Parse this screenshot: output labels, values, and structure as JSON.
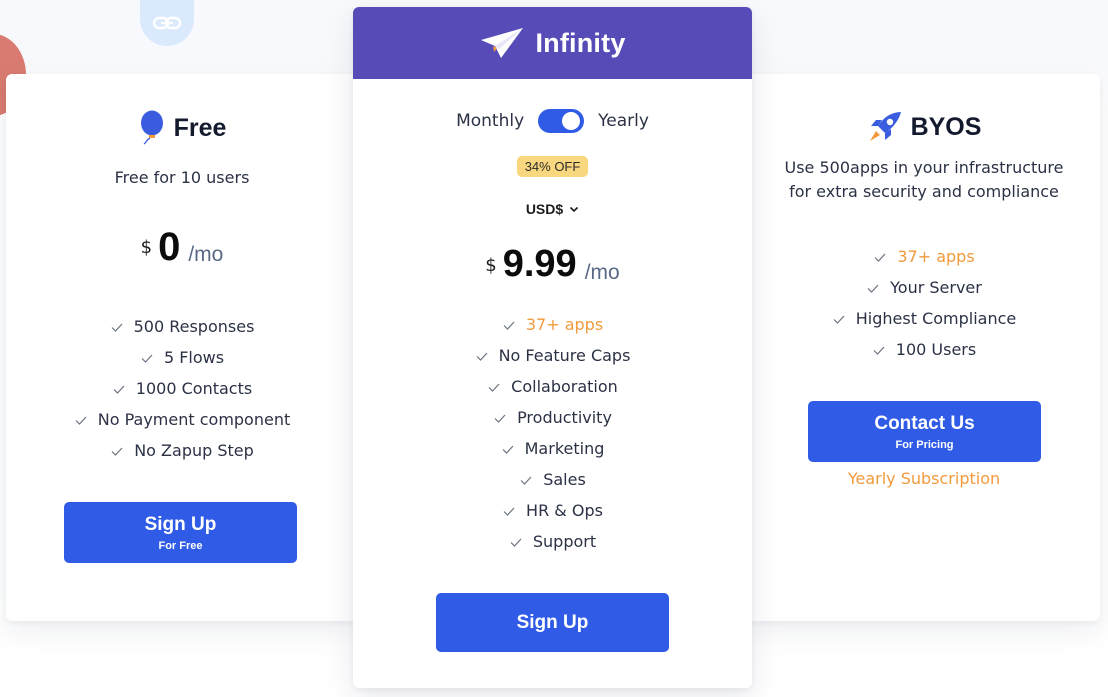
{
  "colors": {
    "primary": "#2f5be6",
    "infinity_header": "#574bb8",
    "highlight": "#f39a3d",
    "badge": "#f9d77e"
  },
  "plans": {
    "free": {
      "icon": "balloon-icon",
      "name": "Free",
      "subtitle": "Free for 10 users",
      "currency_symbol": "$",
      "amount": "0",
      "period": "/mo",
      "features": [
        {
          "text": "500 Responses",
          "highlight": false
        },
        {
          "text": "5 Flows",
          "highlight": false
        },
        {
          "text": "1000 Contacts",
          "highlight": false
        },
        {
          "text": "No Payment component",
          "highlight": false
        },
        {
          "text": "No Zapup Step",
          "highlight": false
        }
      ],
      "button": {
        "label": "Sign Up",
        "sublabel": "For Free"
      }
    },
    "infinity": {
      "icon": "paper-plane-icon",
      "name": "Infinity",
      "billing_toggle": {
        "left_label": "Monthly",
        "right_label": "Yearly",
        "selected": "Yearly"
      },
      "discount_badge": "34% OFF",
      "currency_select": "USD$",
      "currency_symbol": "$",
      "amount": "9.99",
      "period": "/mo",
      "features": [
        {
          "text": "37+ apps",
          "highlight": true
        },
        {
          "text": "No Feature Caps",
          "highlight": false
        },
        {
          "text": "Collaboration",
          "highlight": false
        },
        {
          "text": "Productivity",
          "highlight": false
        },
        {
          "text": "Marketing",
          "highlight": false
        },
        {
          "text": "Sales",
          "highlight": false
        },
        {
          "text": "HR & Ops",
          "highlight": false
        },
        {
          "text": "Support",
          "highlight": false
        }
      ],
      "button": {
        "label": "Sign Up"
      }
    },
    "byos": {
      "icon": "rocket-icon",
      "name": "BYOS",
      "subtitle_lines": [
        "Use 500apps in your infrastructure",
        "for extra security and compliance"
      ],
      "features": [
        {
          "text": "37+ apps",
          "highlight": true
        },
        {
          "text": "Your Server",
          "highlight": false
        },
        {
          "text": "Highest Compliance",
          "highlight": false
        },
        {
          "text": "100 Users",
          "highlight": false
        }
      ],
      "button": {
        "label": "Contact Us",
        "sublabel": "For Pricing"
      },
      "note": "Yearly Subscription"
    }
  },
  "decorations": {
    "top_icon": "link-icon"
  }
}
